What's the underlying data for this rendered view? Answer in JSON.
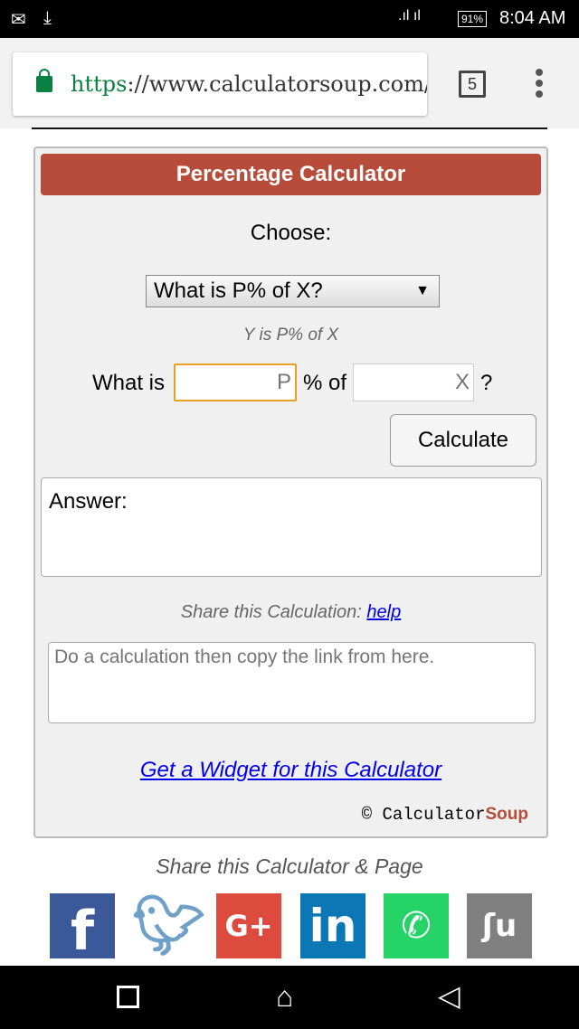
{
  "status": {
    "time": "8:04 AM",
    "battery": "91%"
  },
  "browser": {
    "url_scheme": "https",
    "url_rest": "://www.calculatorsoup.com/c",
    "tab_count": "5"
  },
  "calculator": {
    "title": "Percentage Calculator",
    "choose_label": "Choose:",
    "selected_option": "What is P% of X?",
    "formula": "Y is P% of X",
    "what_is": "What is",
    "p_placeholder": "P",
    "percent_of": "% of",
    "x_placeholder": "X",
    "question": "?",
    "calculate": "Calculate",
    "answer_label": "Answer:",
    "share_label": "Share this Calculation:",
    "help": "help",
    "share_placeholder": "Do a calculation then copy the link from here.",
    "widget_link": "Get a Widget for this Calculator",
    "brand_copy": "©",
    "brand_a": "Calculator",
    "brand_b": "Soup"
  },
  "share": {
    "title": "Share this Calculator & Page",
    "icons": [
      "facebook-icon",
      "twitter-icon",
      "google-plus-icon",
      "linkedin-icon",
      "whatsapp-icon",
      "stumbleupon-icon"
    ]
  },
  "colors": {
    "header": "#b84c3a",
    "facebook": "#3b5998",
    "twitter": "#6fa0c8",
    "google": "#dd4b3e",
    "linkedin": "#0b77b5",
    "whatsapp": "#25d366",
    "stumble": "#808080"
  }
}
